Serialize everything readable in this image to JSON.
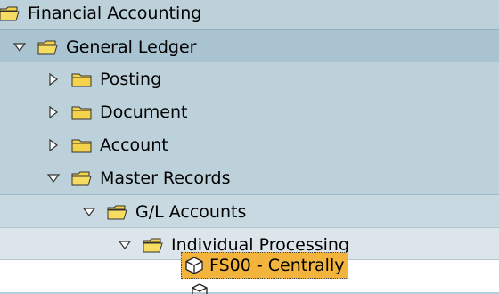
{
  "tree": {
    "financial_accounting": "Financial Accounting",
    "general_ledger": "General Ledger",
    "posting": "Posting",
    "document": "Document",
    "account": "Account",
    "master_records": "Master Records",
    "gl_accounts": "G/L Accounts",
    "individual_processing": "Individual Processing",
    "fs00_centrally": "FS00 - Centrally"
  },
  "icons": {
    "expanded": "triangle-down-icon",
    "collapsed": "triangle-right-icon",
    "open_folder": "open-folder-icon",
    "closed_folder": "folder-icon",
    "transaction": "transaction-cube-icon"
  },
  "colors": {
    "tree_background": "#b7ced8",
    "selected_highlight": "#f3b43d",
    "folder_yellow": "#f4d24a"
  }
}
